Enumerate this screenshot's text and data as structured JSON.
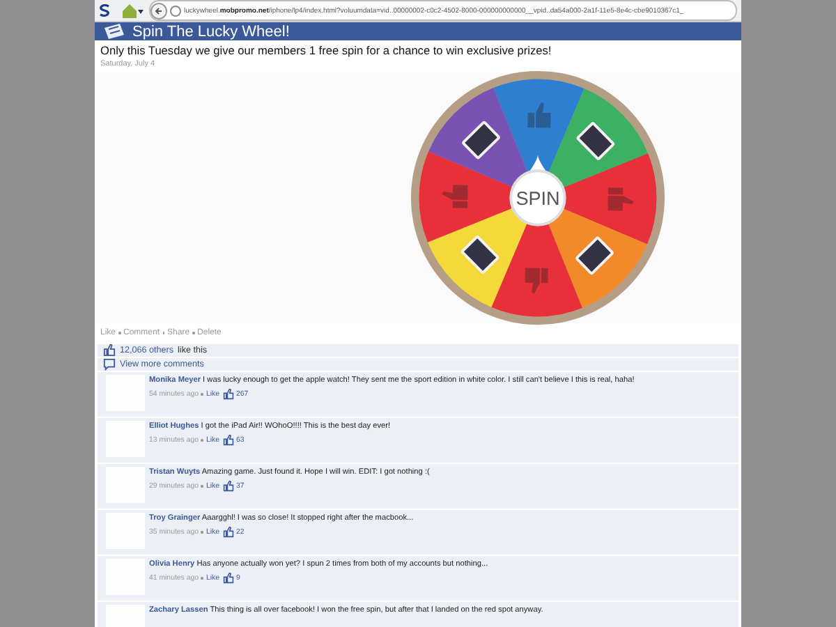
{
  "browser": {
    "url_host": "luckywheel.",
    "url_domain": "mobpromo.net",
    "url_path": "/iphone/lp4/index.html?voluumdata=vid..00000002-c0c2-4502-8000-000000000000__vpid..da54a000-2a1f-11e5-8e4c-cbe9010367c1_"
  },
  "header": {
    "title": "Spin The Lucky Wheel!"
  },
  "post": {
    "text": "Only this Tuesday we give our members 1 free spin for a chance to win exclusive prizes!",
    "date": "Saturday, July 4"
  },
  "wheel": {
    "center_label": "SPIN",
    "segments": [
      {
        "kind": "thumb",
        "color": "#2f7fd0"
      },
      {
        "kind": "device",
        "color": "#3cb063"
      },
      {
        "kind": "thumb",
        "color": "#e8303a"
      },
      {
        "kind": "device",
        "color": "#f28a2a"
      },
      {
        "kind": "thumb",
        "color": "#e8303a"
      },
      {
        "kind": "device",
        "color": "#f5d93a"
      },
      {
        "kind": "thumb",
        "color": "#e8303a"
      },
      {
        "kind": "device",
        "color": "#7a52b3"
      }
    ]
  },
  "actions": [
    "Like",
    "Comment",
    "Share",
    "Delete"
  ],
  "likes": {
    "count": "12,066 others",
    "suffix": "like this"
  },
  "view_more": "View more comments",
  "comments": [
    {
      "name": "Monika Meyer",
      "text": "I was lucky enough to get the apple watch! They sent me the sport edition in white color. I still can't believe I this is real, haha!",
      "time": "54 minutes ago",
      "like": "Like",
      "likes": "267"
    },
    {
      "name": "Elliot Hughes",
      "text": "I got the iPad Air!! WOhoO!!!! This is the best day ever!",
      "time": "13 minutes ago",
      "like": "Like",
      "likes": "63"
    },
    {
      "name": "Tristan Wuyts",
      "text": "Amazing game. Just found it. Hope I will win. EDIT: I got nothing :(",
      "time": "29 minutes ago",
      "like": "Like",
      "likes": "37"
    },
    {
      "name": "Troy Grainger",
      "text": "Aaargghl! I was so close! It stopped right after the macbook...",
      "time": "35 minutes ago",
      "like": "Like",
      "likes": "22"
    },
    {
      "name": "Olivia Henry",
      "text": "Has anyone actually won yet? I spun 2 times from both of my accounts but nothing...",
      "time": "41 minutes ago",
      "like": "Like",
      "likes": "9"
    },
    {
      "name": "Zachary Lassen",
      "text": "This thing is all over facebook! I won the free spin, but after that I landed on the red spot anyway."
    }
  ]
}
